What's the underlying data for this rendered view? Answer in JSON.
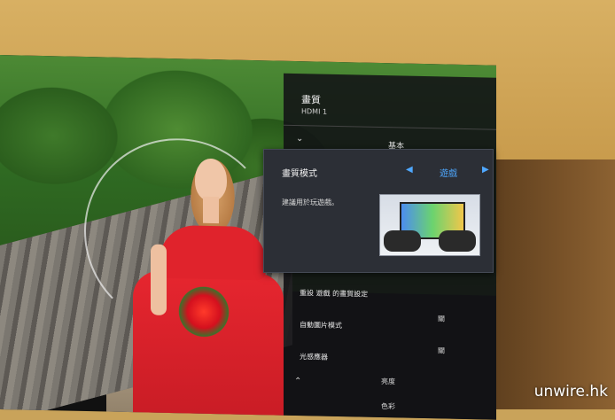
{
  "menu": {
    "title": "畫質",
    "source": "HDMI 1",
    "category": "基本",
    "picture_mode": {
      "label": "畫質模式",
      "value": "遊戲",
      "description": "建議用於玩遊戲。",
      "thumbnail_icon": "gaming-scene-thumbnail"
    },
    "items": [
      {
        "label": "重設 遊戲 的畫質設定",
        "value": ""
      },
      {
        "label": "自動圖片模式",
        "value": "關"
      },
      {
        "label": "光感應器",
        "value": "關"
      },
      {
        "label": "",
        "value": "亮度"
      },
      {
        "label": "",
        "value": "色彩"
      }
    ]
  },
  "icons": {
    "left": "arrow-left-icon",
    "right": "arrow-right-icon",
    "down": "chevron-down-icon",
    "up": "chevron-up-icon"
  },
  "colors": {
    "accent": "#4fa8ff",
    "panel": "#2c2f36"
  },
  "watermark": "unwire.hk"
}
